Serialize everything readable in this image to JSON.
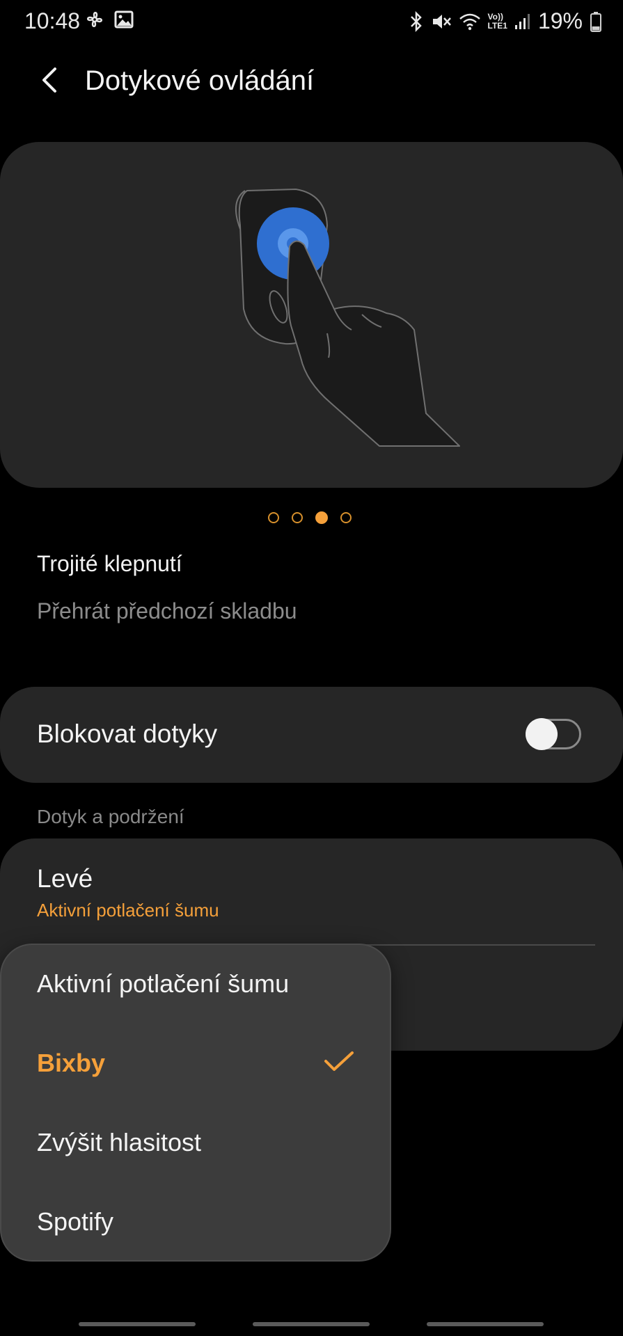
{
  "status_bar": {
    "time": "10:48",
    "battery_percent": "19%",
    "network_label_top": "Vo))",
    "network_label_bottom": "LTE1",
    "icons": [
      "fan-icon",
      "image-icon",
      "bluetooth-icon",
      "mute-icon",
      "wifi-icon",
      "signal-icon",
      "battery-icon"
    ]
  },
  "header": {
    "title": "Dotykové ovládání"
  },
  "pager": {
    "count": 4,
    "active_index": 2
  },
  "gesture": {
    "title": "Trojité klepnutí",
    "action": "Přehrát předchozí skladbu"
  },
  "block_touches": {
    "label": "Blokovat dotyky",
    "enabled": false
  },
  "touch_and_hold": {
    "section_header": "Dotyk a podržení",
    "left_label": "Levé",
    "left_value": "Aktivní potlačení šumu"
  },
  "popup_menu": {
    "options": [
      "Aktivní potlačení šumu",
      "Bixby",
      "Zvýšit hlasitost",
      "Spotify"
    ],
    "selected": "Bixby"
  },
  "colors": {
    "accent": "#f5a03a",
    "card": "#262626",
    "popup": "#3c3c3c",
    "illustration_highlight": "#2f6fd0"
  }
}
